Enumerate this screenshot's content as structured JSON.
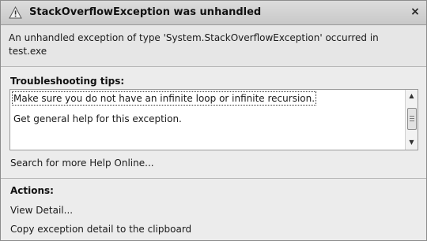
{
  "dialog": {
    "title": "StackOverflowException was unhandled",
    "close_glyph": "×",
    "message": "An unhandled exception of type 'System.StackOverflowException' occurred in test.exe"
  },
  "tips": {
    "heading": "Troubleshooting tips:",
    "items": [
      "Make sure you do not have an infinite loop or infinite recursion.",
      "Get general help for this exception."
    ]
  },
  "help_link": "Search for more Help Online...",
  "actions": {
    "heading": "Actions:",
    "items": [
      "View Detail...",
      "Copy exception detail to the clipboard"
    ]
  },
  "icons": {
    "title": "warning-icon",
    "close": "close-icon",
    "scroll_up": "scroll-up-arrow-icon",
    "scroll_down": "scroll-down-arrow-icon"
  },
  "colors": {
    "titlebar": "#cfcfcf",
    "background": "#ececec"
  }
}
